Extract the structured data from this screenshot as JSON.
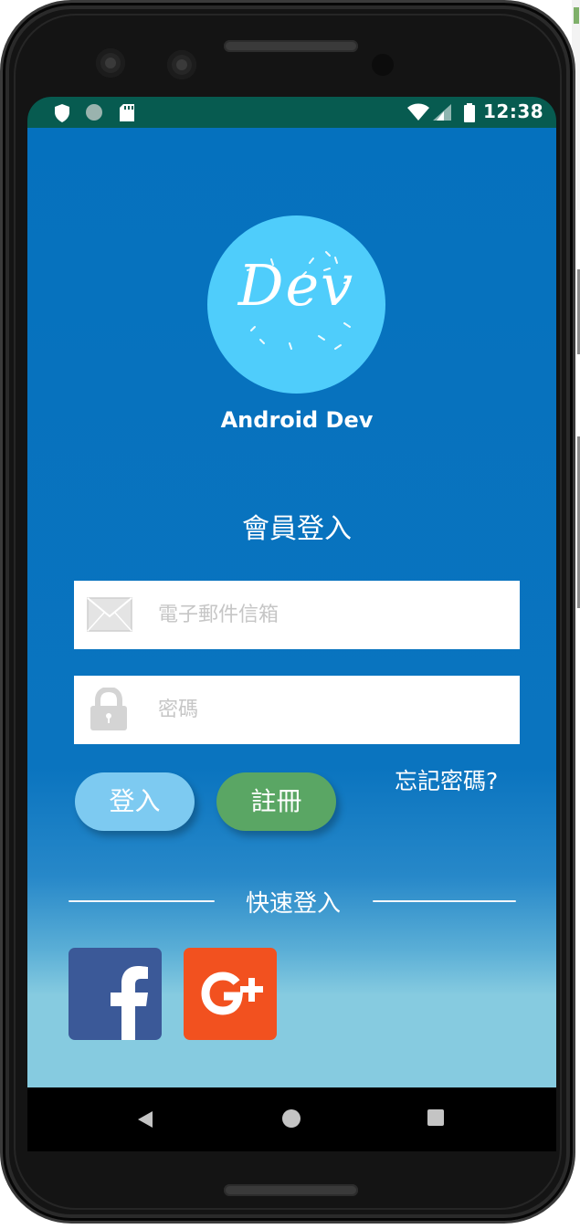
{
  "status_bar": {
    "time": "12:38",
    "left_icons": [
      "shield-icon",
      "circle-icon",
      "sd-card-icon"
    ],
    "right_icons": [
      "wifi-icon",
      "signal-icon",
      "battery-icon"
    ]
  },
  "logo": {
    "text": "Dev",
    "app_name": "Android Dev",
    "circle_color": "#4fcdfb"
  },
  "login": {
    "title": "會員登入",
    "email_placeholder": "電子郵件信箱",
    "password_placeholder": "密碼",
    "login_button": "登入",
    "register_button": "註冊",
    "forgot_password": "忘記密碼?"
  },
  "quick_login": {
    "title": "快速登入",
    "providers": [
      {
        "name": "facebook",
        "icon": "facebook-icon",
        "color": "#3b5998"
      },
      {
        "name": "google-plus",
        "icon": "google-plus-icon",
        "color": "#f2511f"
      }
    ]
  },
  "colors": {
    "status_bar": "#075b50",
    "app_background_top": "#0571be",
    "app_background_bottom": "#86cbe0",
    "login_button": "#7dcaf1",
    "register_button": "#5aa664"
  },
  "nav_bar": {
    "buttons": [
      "back-icon",
      "home-icon",
      "recent-apps-icon"
    ]
  }
}
